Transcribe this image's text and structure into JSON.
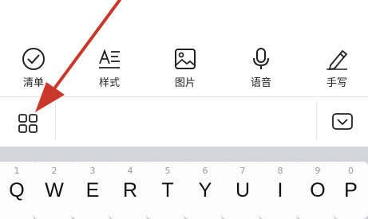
{
  "toolbar": {
    "items": [
      {
        "label": "清单",
        "icon": "checklist-icon"
      },
      {
        "label": "样式",
        "icon": "text-style-icon"
      },
      {
        "label": "图片",
        "icon": "image-icon"
      },
      {
        "label": "语音",
        "icon": "microphone-icon"
      },
      {
        "label": "手写",
        "icon": "pen-icon"
      }
    ]
  },
  "secondary_bar": {
    "left_icon": "grid-icon",
    "right_icon": "keyboard-collapse-icon"
  },
  "annotation": {
    "icon": "red-arrow",
    "color": "#c9382a"
  },
  "keyboard": {
    "keys": [
      {
        "num": "1",
        "char": "Q"
      },
      {
        "num": "2",
        "char": "W"
      },
      {
        "num": "3",
        "char": "E"
      },
      {
        "num": "4",
        "char": "R"
      },
      {
        "num": "5",
        "char": "T"
      },
      {
        "num": "6",
        "char": "Y"
      },
      {
        "num": "7",
        "char": "U"
      },
      {
        "num": "8",
        "char": "I"
      },
      {
        "num": "9",
        "char": "O"
      },
      {
        "num": "0",
        "char": "P"
      }
    ]
  }
}
